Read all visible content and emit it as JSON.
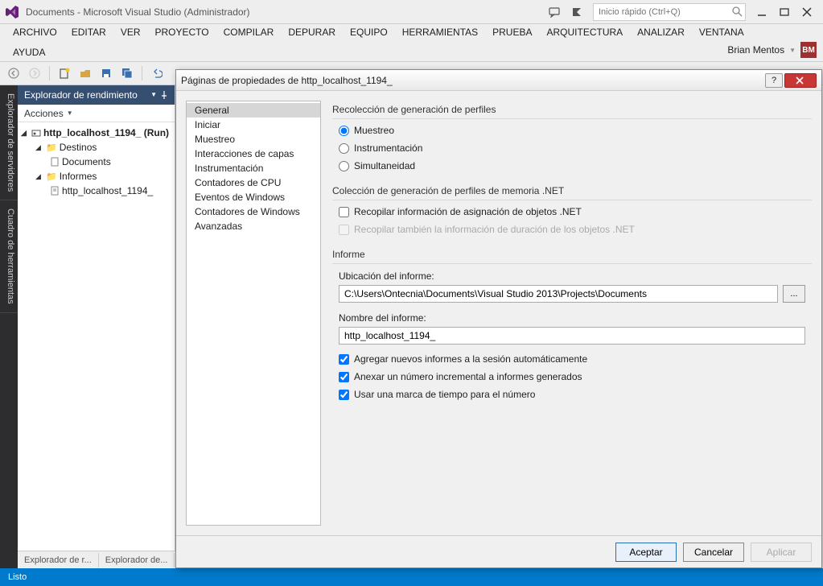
{
  "window": {
    "title": "Documents - Microsoft Visual Studio (Administrador)",
    "search_placeholder": "Inicio rápido (Ctrl+Q)"
  },
  "menu": {
    "items": [
      "ARCHIVO",
      "EDITAR",
      "VER",
      "PROYECTO",
      "COMPILAR",
      "DEPURAR",
      "EQUIPO",
      "HERRAMIENTAS",
      "PRUEBA",
      "ARQUITECTURA",
      "ANALIZAR",
      "VENTANA"
    ],
    "row2": [
      "AYUDA"
    ],
    "user": "Brian Mentos",
    "user_initials": "BM"
  },
  "side_tabs": [
    "Explorador de servidores",
    "Cuadro de herramientas"
  ],
  "explorer": {
    "title": "Explorador de rendimiento",
    "actions_label": "Acciones",
    "tree": {
      "root": "http_localhost_1194_ (Run)",
      "node1": "Destinos",
      "leaf1": "Documents",
      "node2": "Informes",
      "leaf2": "http_localhost_1194_"
    }
  },
  "bottom_tabs": [
    "Explorador de r...",
    "Explorador de..."
  ],
  "status": "Listo",
  "dialog": {
    "title": "Páginas de propiedades de http_localhost_1194_",
    "categories": [
      "General",
      "Iniciar",
      "Muestreo",
      "Interacciones de capas",
      "Instrumentación",
      "Contadores de CPU",
      "Eventos de Windows",
      "Contadores de Windows",
      "Avanzadas"
    ],
    "group1_label": "Recolección de generación de perfiles",
    "radio1": "Muestreo",
    "radio2": "Instrumentación",
    "radio3": "Simultaneidad",
    "group2_label": "Colección de generación de perfiles de memoria .NET",
    "check1": "Recopilar información de asignación de objetos .NET",
    "check2": "Recopilar también la información de duración de los objetos .NET",
    "group3_label": "Informe",
    "loc_label": "Ubicación del informe:",
    "loc_value": "C:\\Users\\Ontecnia\\Documents\\Visual Studio 2013\\Projects\\Documents",
    "name_label": "Nombre del informe:",
    "name_value": "http_localhost_1194_",
    "check3": "Agregar nuevos informes a la sesión automáticamente",
    "check4": "Anexar un número incremental a informes generados",
    "check5": "Usar una marca de tiempo para el número",
    "browse": "...",
    "btn_ok": "Aceptar",
    "btn_cancel": "Cancelar",
    "btn_apply": "Aplicar"
  }
}
